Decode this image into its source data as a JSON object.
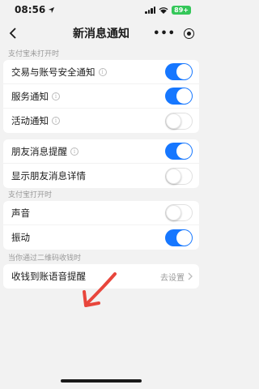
{
  "status": {
    "time": "08:56",
    "battery": "89+"
  },
  "nav": {
    "title": "新消息通知",
    "more": "•••"
  },
  "sections": [
    {
      "label": "支付宝未打开时",
      "rows": [
        {
          "label": "交易与账号安全通知",
          "info": true,
          "on": true
        },
        {
          "label": "服务通知",
          "info": true,
          "on": true
        },
        {
          "label": "活动通知",
          "info": true,
          "on": false
        }
      ]
    },
    {
      "label": "",
      "rows": [
        {
          "label": "朋友消息提醒",
          "info": true,
          "on": true
        },
        {
          "label": "显示朋友消息详情",
          "info": false,
          "on": false
        }
      ]
    },
    {
      "label": "支付宝打开时",
      "rows": [
        {
          "label": "声音",
          "info": false,
          "on": false
        },
        {
          "label": "振动",
          "info": false,
          "on": true
        }
      ]
    }
  ],
  "qr_section": {
    "label": "当你通过二维码收钱时",
    "row_label": "收钱到账语音提醒",
    "row_value": "去设置"
  },
  "colors": {
    "accent": "#1677ff",
    "arrow": "#e8463c"
  },
  "icons": {
    "info": "i",
    "chevron": "›",
    "back": "‹"
  }
}
